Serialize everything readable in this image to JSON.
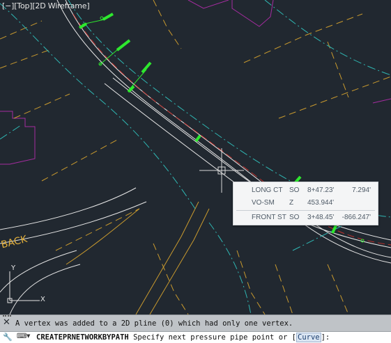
{
  "viewport": {
    "label": "[−][Top][2D Wireframe]"
  },
  "street_label": "BACK",
  "tooltip": {
    "rows": [
      {
        "name": "LONG CT",
        "side": "SO",
        "station": "8+47.23'",
        "offset": "7.294'"
      },
      {
        "name": "VO-SM",
        "side": "Z",
        "station": "453.944'",
        "offset": ""
      },
      {
        "name": "FRONT ST",
        "side": "SO",
        "station": "3+48.45'",
        "offset": "-866.247'"
      }
    ]
  },
  "ucs": {
    "x_label": "X",
    "y_label": "Y"
  },
  "command": {
    "history": "A vertex was added to a 2D pline (0) which had only one vertex.",
    "name": "CREATEPRNETWORKBYPATH",
    "prompt": "Specify next pressure pipe point or [",
    "option": "Curve",
    "suffix": "]:"
  },
  "icons": [
    "close-icon",
    "wrench-icon",
    "prompt-icon",
    "dropdown-icon"
  ],
  "colors": {
    "background": "#212830",
    "road_lines": "#e6e6e6",
    "cyan_lines": "#2fb7b3",
    "yellow_lines": "#c99a2e",
    "magenta_lines": "#a52ca0",
    "pipe_markers": "#2ee82e",
    "red_centerline": "#c0302c"
  }
}
